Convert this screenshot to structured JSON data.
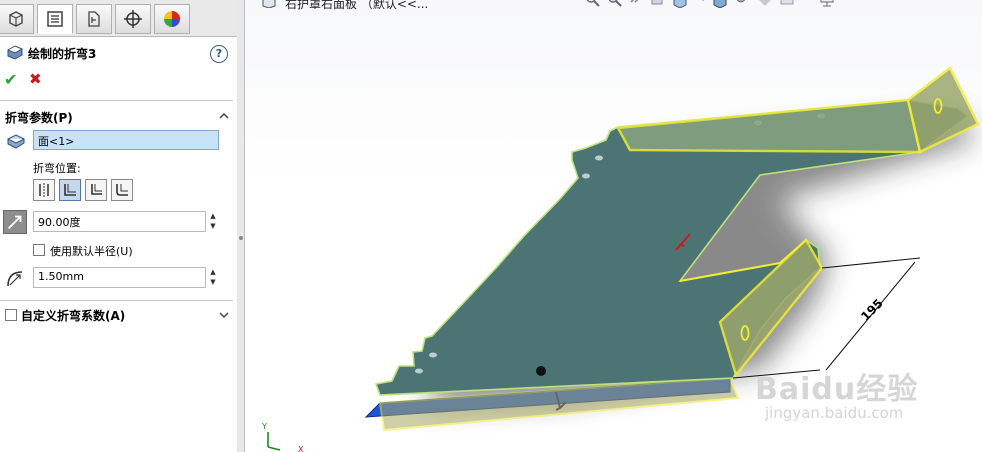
{
  "breadcrumb": {
    "text": "右护罩右面板 （默认<<..."
  },
  "feature": {
    "title": "绘制的折弯3",
    "help": "?"
  },
  "actions": {
    "ok": "✔",
    "cancel": "✖"
  },
  "bend_params": {
    "title": "折弯参数(P)",
    "face_selection": "面<1>",
    "bend_position_label": "折弯位置:",
    "angle": "90.00度",
    "use_default_radius": {
      "label": "使用默认半径(U)",
      "checked": false
    },
    "radius": "1.50mm"
  },
  "custom_bend": {
    "title": "自定义折弯系数(A)",
    "checked": false
  },
  "dimension": {
    "value": "195"
  },
  "watermark": {
    "brand": "Baidu经验",
    "url": "jingyan.baidu.com"
  },
  "axes": {
    "y": "Y",
    "x": "X"
  },
  "colors": {
    "sheet": "#4d7474",
    "highlight": "#f2ec32",
    "bend": "#1f56d6",
    "selection": "#c8e2f7"
  }
}
